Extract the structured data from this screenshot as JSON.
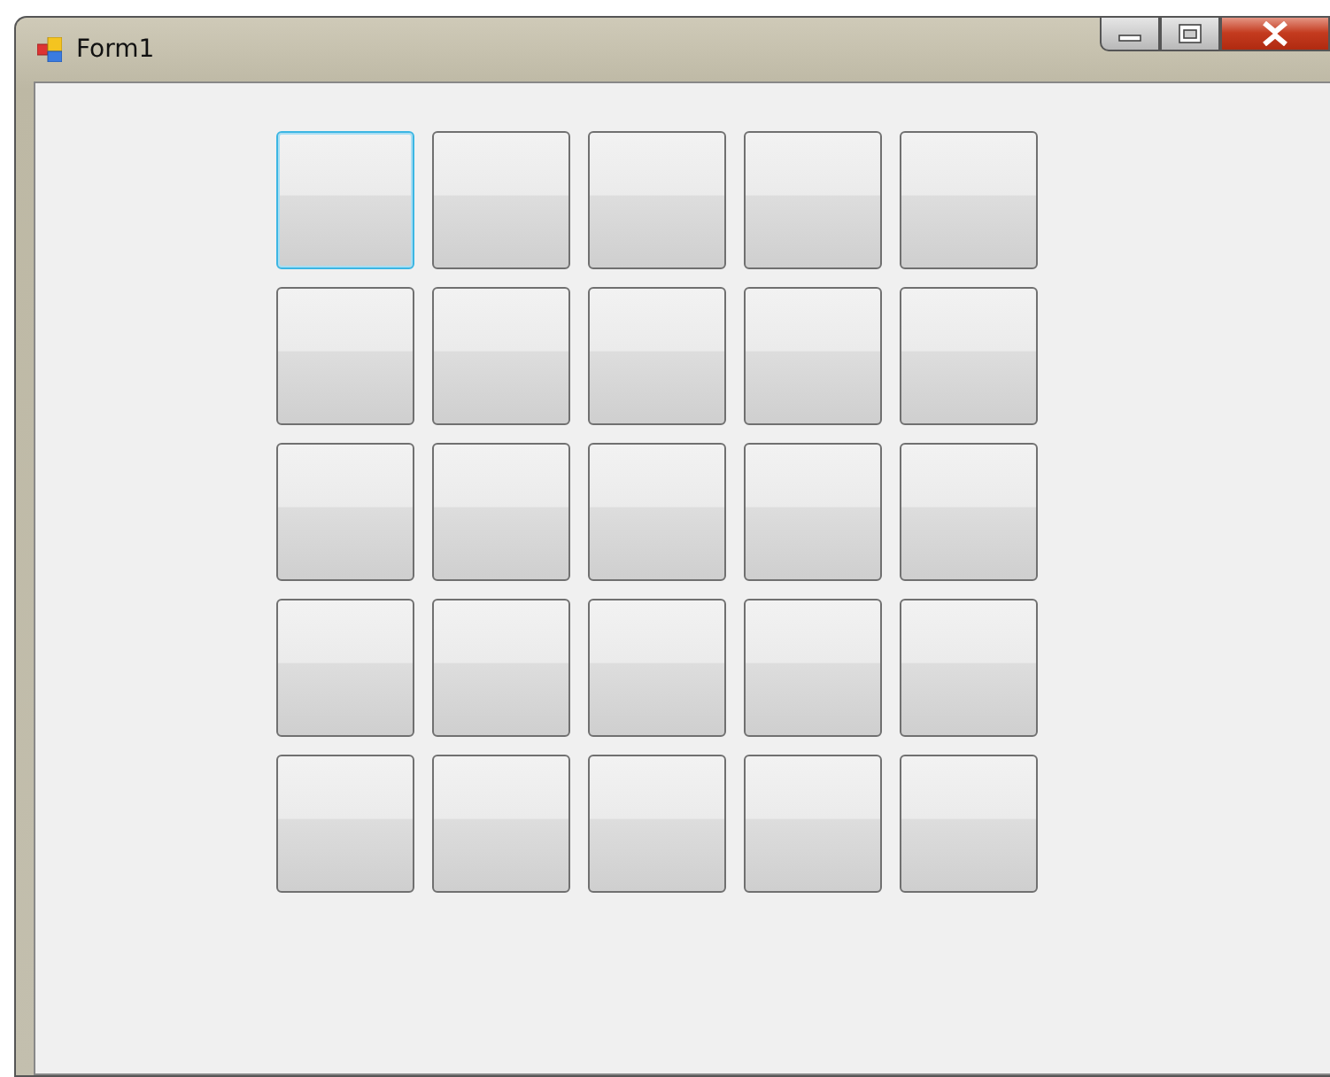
{
  "window": {
    "title": "Form1"
  },
  "grid": [
    [
      {
        "focused": true
      },
      {
        "focused": false
      },
      {
        "focused": false
      },
      {
        "focused": false
      },
      {
        "focused": false
      }
    ],
    [
      {
        "focused": false
      },
      {
        "focused": false
      },
      {
        "focused": false
      },
      {
        "focused": false
      },
      {
        "focused": false
      }
    ],
    [
      {
        "focused": false
      },
      {
        "focused": false
      },
      {
        "focused": false
      },
      {
        "focused": false
      },
      {
        "focused": false
      }
    ],
    [
      {
        "focused": false
      },
      {
        "focused": false
      },
      {
        "focused": false
      },
      {
        "focused": false
      },
      {
        "focused": false
      }
    ],
    [
      {
        "focused": false
      },
      {
        "focused": false
      },
      {
        "focused": false
      },
      {
        "focused": false
      },
      {
        "focused": false
      }
    ]
  ]
}
